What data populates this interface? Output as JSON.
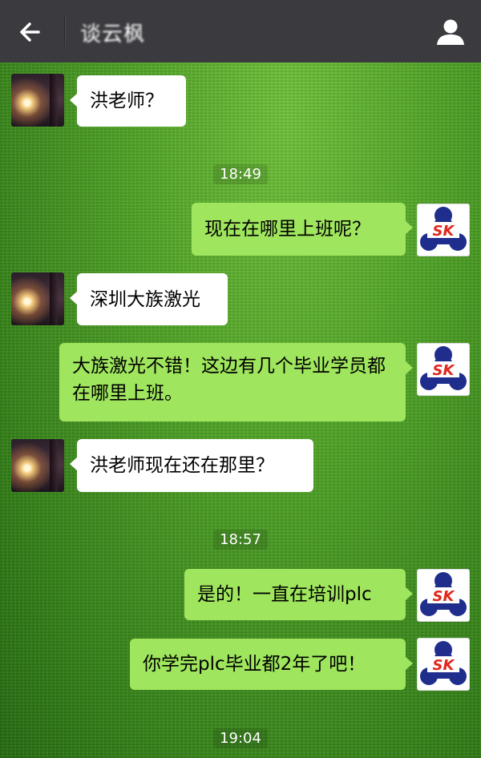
{
  "header": {
    "title": "谈云枫",
    "back_icon": "arrow-left-icon",
    "profile_icon": "person-icon"
  },
  "avatars": {
    "contact": "contact-avatar",
    "self_logo_text": "SK"
  },
  "colors": {
    "header_bg": "#3a3a3f",
    "sent_bubble": "#9fe55d",
    "received_bubble": "#ffffff",
    "logo_blue": "#1f2e8c",
    "logo_red": "#e0281c"
  },
  "messages": [
    {
      "type": "received",
      "text": "洪老师？"
    },
    {
      "type": "time",
      "text": "18:49"
    },
    {
      "type": "sent",
      "text": "现在在哪里上班呢？"
    },
    {
      "type": "received",
      "text": "深圳大族激光"
    },
    {
      "type": "sent",
      "text": "大族激光不错！这边有几个毕业学员都在哪里上班。"
    },
    {
      "type": "received",
      "text": "洪老师现在还在那里？"
    },
    {
      "type": "time",
      "text": "18:57"
    },
    {
      "type": "sent",
      "text": "是的！一直在培训plc"
    },
    {
      "type": "sent",
      "text": "你学完plc毕业都2年了吧！"
    },
    {
      "type": "time",
      "text": "19:04"
    }
  ]
}
